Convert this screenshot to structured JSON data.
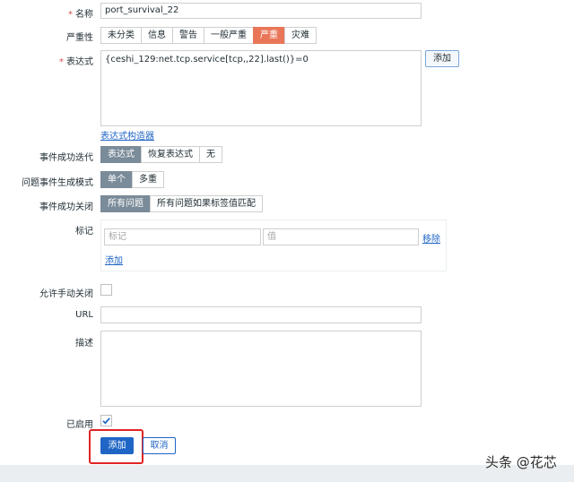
{
  "form": {
    "name": {
      "label": "名称",
      "value": "port_survival_22"
    },
    "severity": {
      "label": "严重性",
      "options": [
        "未分类",
        "信息",
        "警告",
        "一般严重",
        "严重",
        "灾难"
      ]
    },
    "expression": {
      "label": "表达式",
      "value": "{ceshi_129:net.tcp.service[tcp,,22].last()}=0",
      "add_button": "添加",
      "constructor_link": "表达式构造器"
    },
    "ok_event_generation": {
      "label": "事件成功迭代",
      "options": [
        "表达式",
        "恢复表达式",
        "无"
      ]
    },
    "problem_event_mode": {
      "label": "问题事件生成模式",
      "options": [
        "单个",
        "多重"
      ]
    },
    "ok_event_closes": {
      "label": "事件成功关闭",
      "options": [
        "所有问题",
        "所有问题如果标签值匹配"
      ]
    },
    "tags": {
      "label": "标记",
      "tag_placeholder": "标记",
      "value_placeholder": "值",
      "remove_link": "移除",
      "add_link": "添加"
    },
    "allow_manual_close": {
      "label": "允许手动关闭"
    },
    "url": {
      "label": "URL"
    },
    "description": {
      "label": "描述"
    },
    "enabled": {
      "label": "已启用"
    },
    "actions": {
      "add_button": "添加",
      "cancel_button": "取消"
    }
  },
  "watermark": "头条 @花芯"
}
